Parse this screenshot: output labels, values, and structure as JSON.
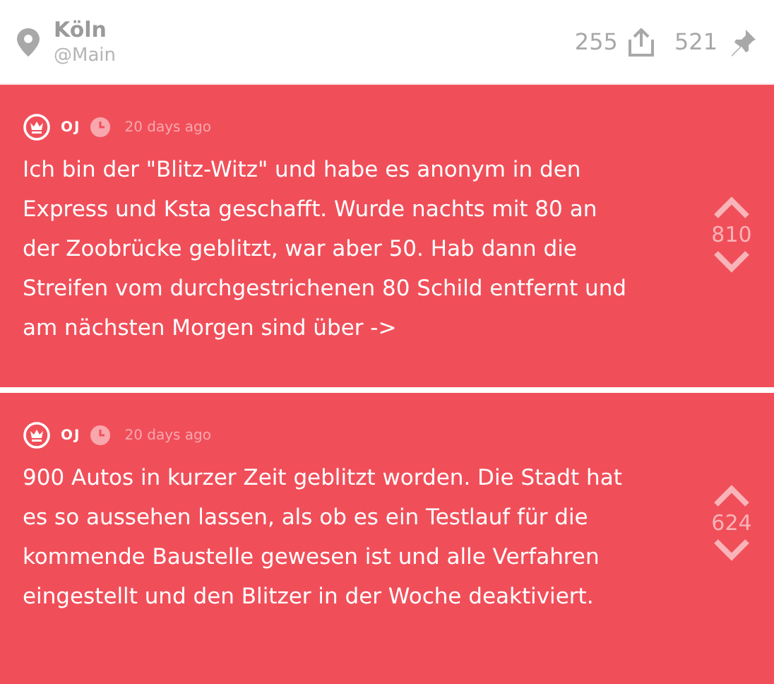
{
  "header": {
    "city": "Köln",
    "channel": "@Main",
    "share_count": "255",
    "pin_count": "521"
  },
  "posts": [
    {
      "author": "OJ",
      "time": "20 days ago",
      "text": "Ich bin der \"Blitz-Witz\" und habe es anonym in den Express und Ksta geschafft. Wurde nachts mit 80 an der Zoobrücke geblitzt, war aber 50. Hab dann die Streifen vom durchgestrichenen 80 Schild entfernt und am nächsten Morgen sind über ->",
      "votes": "810"
    },
    {
      "author": "OJ",
      "time": "20 days ago",
      "text": "900 Autos in kurzer Zeit geblitzt worden. Die Stadt hat es so aussehen lassen, als ob es ein Testlauf für die kommende Baustelle gewesen ist und alle Verfahren eingestellt und den Blitzer in der Woche deaktiviert.",
      "votes": "624"
    }
  ]
}
